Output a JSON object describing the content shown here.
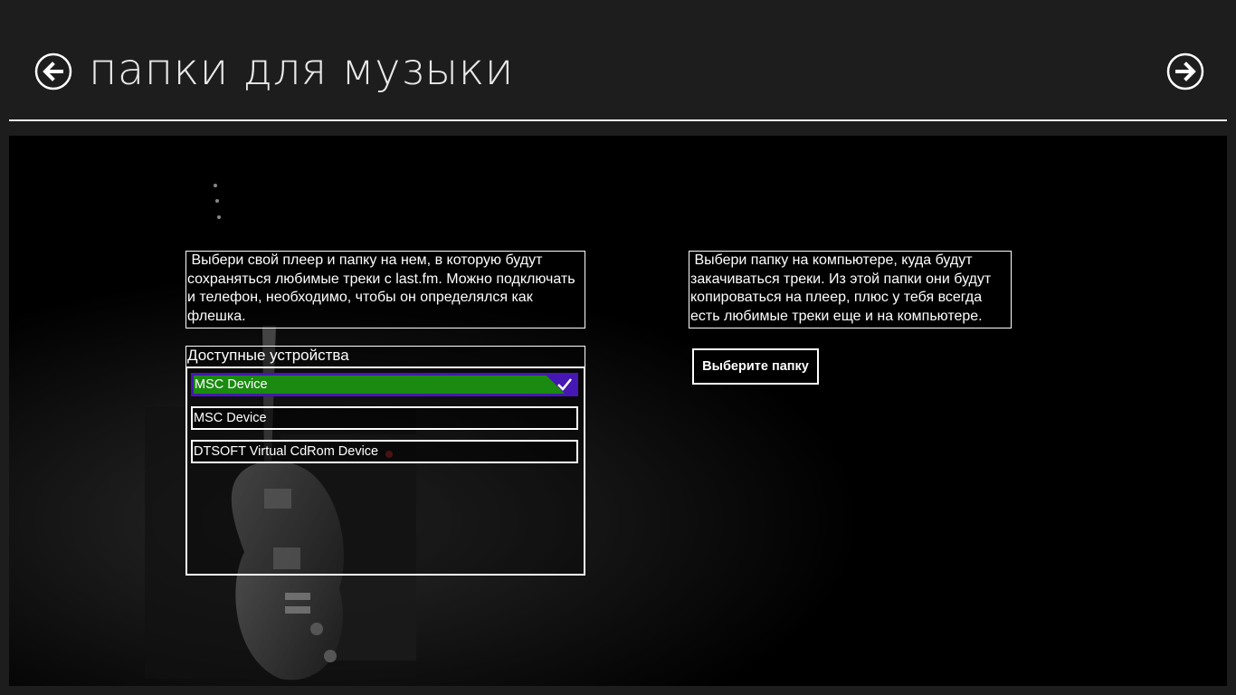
{
  "header": {
    "title": "папки для музыки",
    "back_icon": "arrow-left-circle-icon",
    "forward_icon": "arrow-right-circle-icon"
  },
  "left_panel": {
    "info_text": " Выбери свой плеер и папку на нем, в которую будут сохраняться любимые треки с last.fm. Можно подключать и телефон, необходимо, чтобы он определялся как флешка.",
    "devices_header": "Доступные устройства",
    "devices": [
      {
        "label": "MSC Device",
        "selected": true
      },
      {
        "label": "MSC Device",
        "selected": false
      },
      {
        "label": "DTSOFT Virtual CdRom Device",
        "selected": false
      }
    ]
  },
  "right_panel": {
    "info_text": " Выбери папку на компьютере, куда будут закачиваться треки. Из этой папки они будут копироваться на плеер, плюс у тебя всегда есть любимые треки еще и на компьютере.",
    "choose_button": "Выберите папку"
  },
  "colors": {
    "background": "#1d1d1d",
    "selection_fill": "#1a8a10",
    "selection_border": "#4617b4"
  }
}
